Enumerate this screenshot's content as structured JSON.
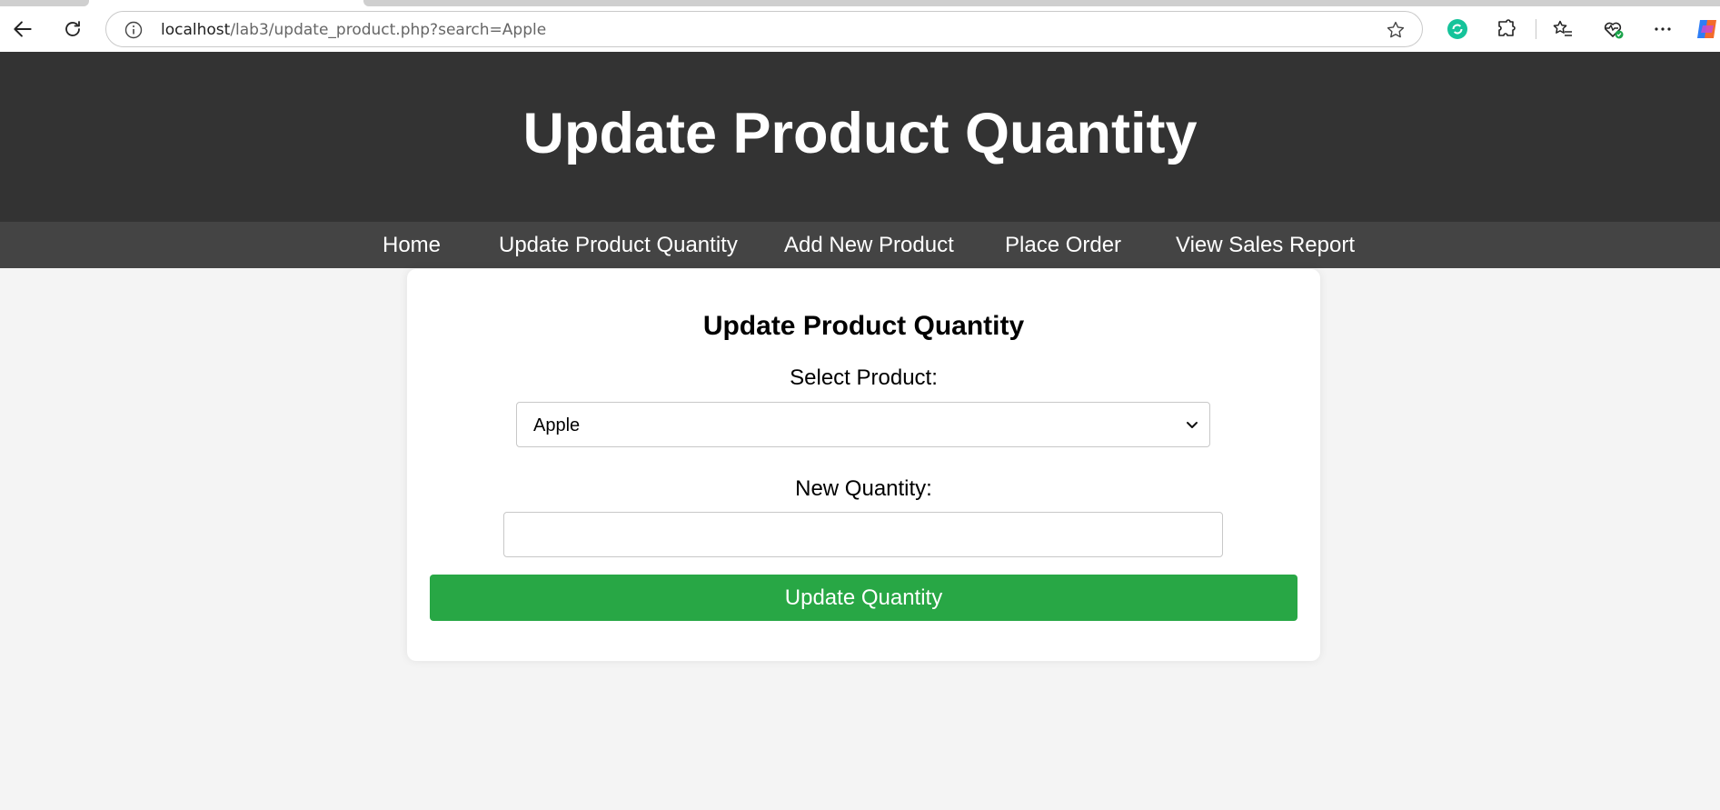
{
  "browser": {
    "url_host": "localhost",
    "url_path": "/lab3/update_product.php?search=Apple"
  },
  "header": {
    "title": "Update Product Quantity"
  },
  "nav": {
    "items": [
      {
        "label": "Home"
      },
      {
        "label": "Update Product Quantity"
      },
      {
        "label": "Add New Product"
      },
      {
        "label": "Place Order"
      },
      {
        "label": "View Sales Report"
      }
    ]
  },
  "form": {
    "title": "Update Product Quantity",
    "product_label": "Select Product:",
    "product_selected": "Apple",
    "quantity_label": "New Quantity:",
    "quantity_value": "",
    "submit_label": "Update Quantity"
  },
  "colors": {
    "header_bg": "#333333",
    "nav_bg": "#444444",
    "page_bg": "#f4f4f4",
    "button_bg": "#28a745"
  }
}
